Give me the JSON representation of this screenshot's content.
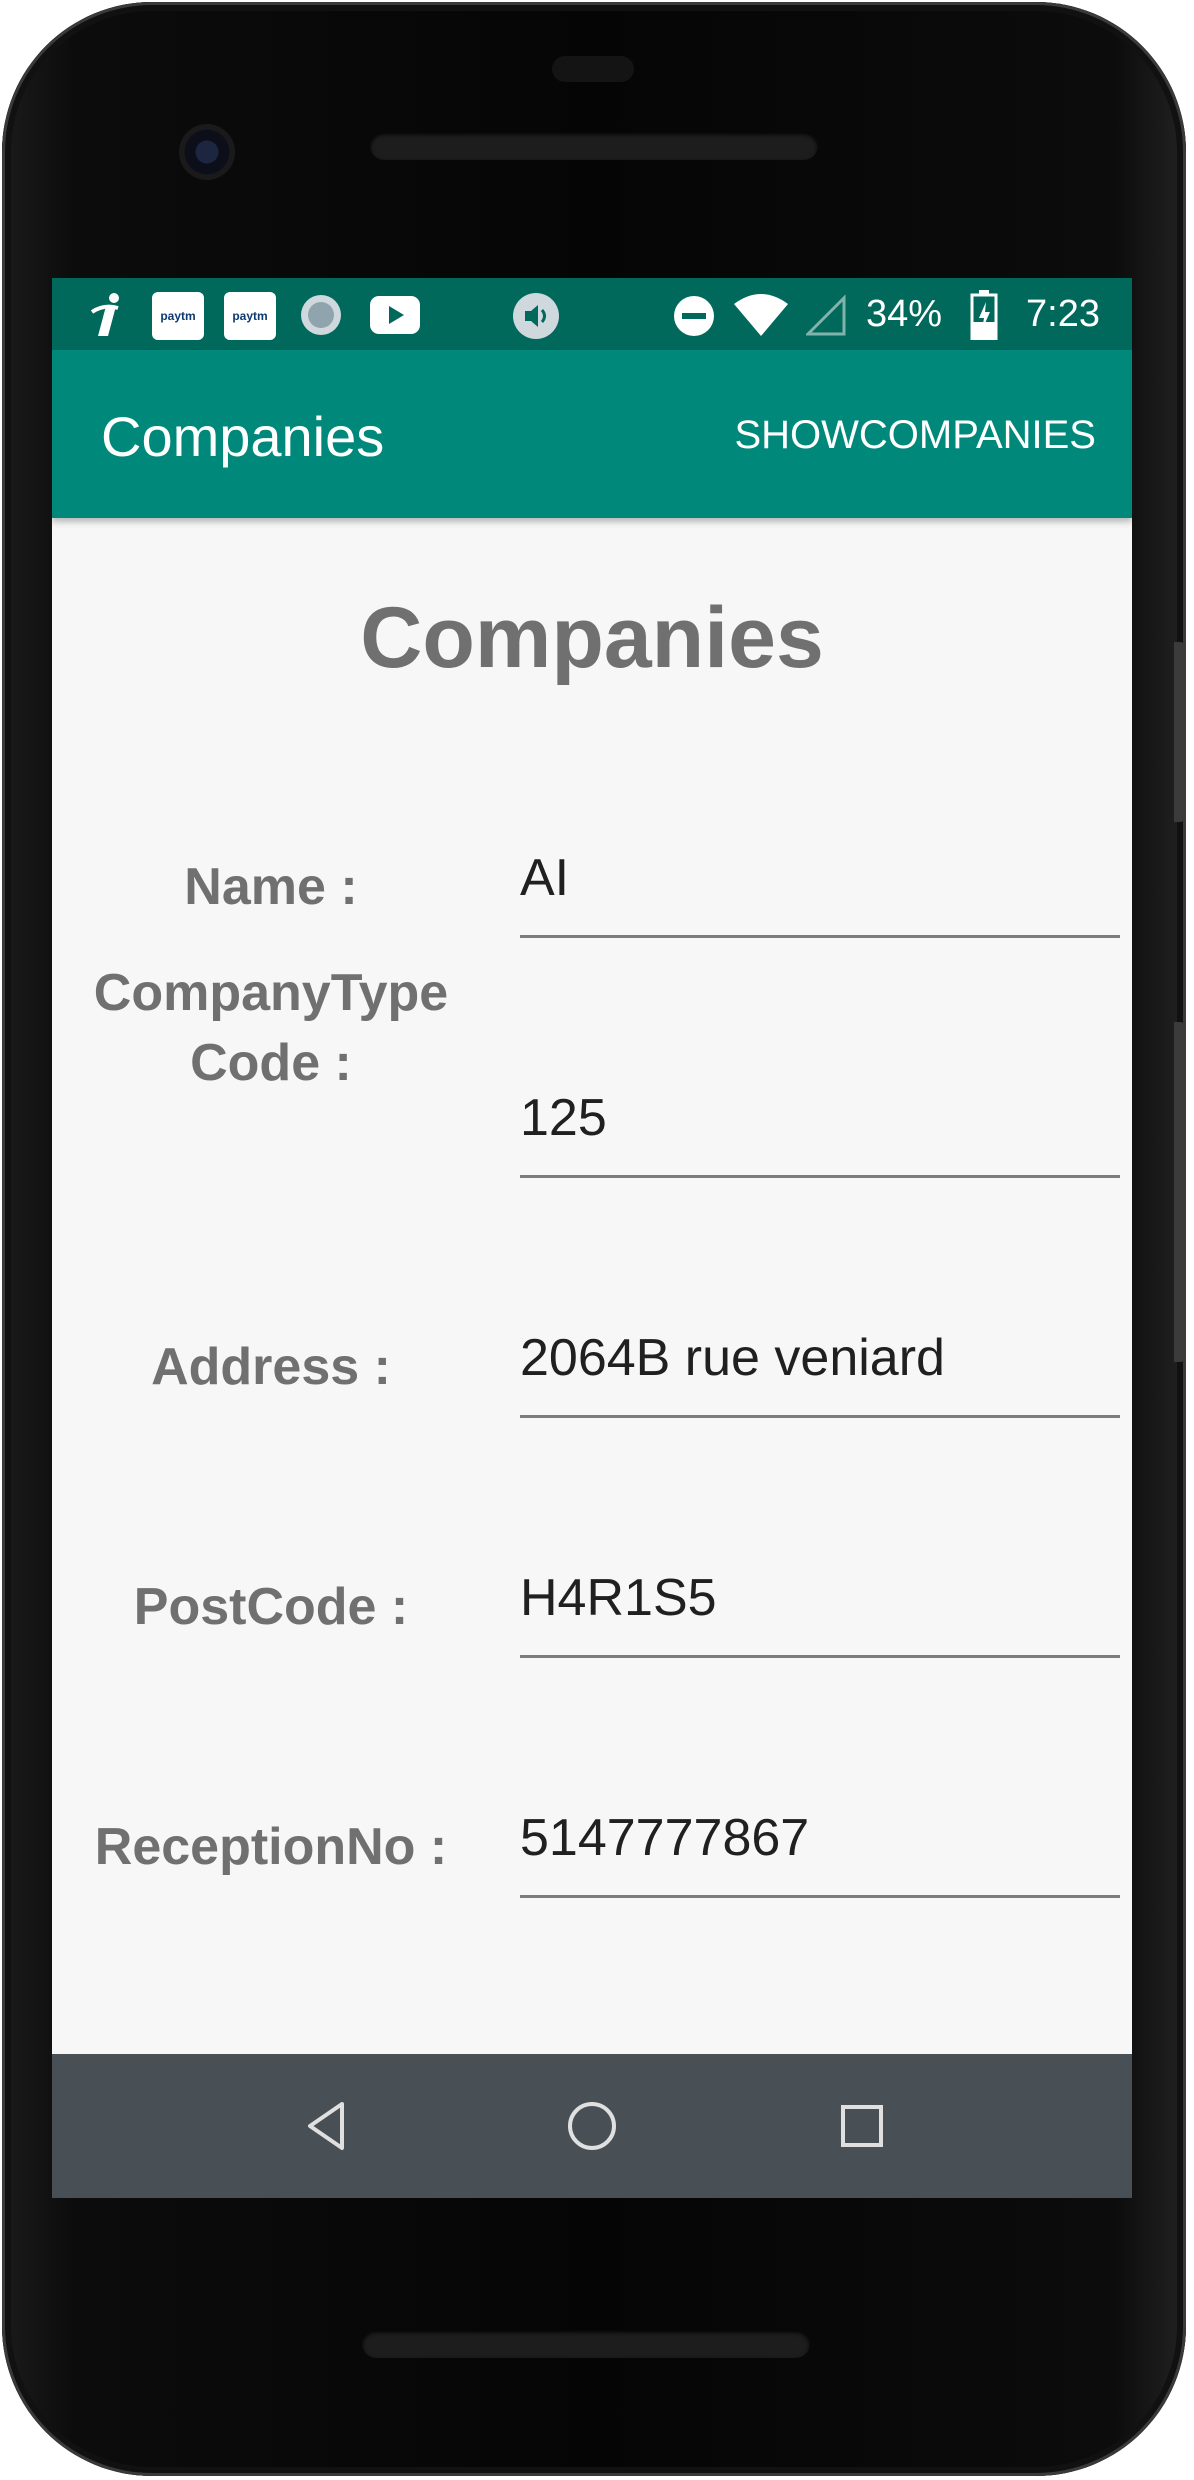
{
  "status_bar": {
    "battery": "34%",
    "time": "7:23",
    "paytm_label": "paytm"
  },
  "app_bar": {
    "title": "Companies",
    "action": "SHOWCOMPANIES"
  },
  "page": {
    "heading": "Companies",
    "fields": [
      {
        "label": "Name :",
        "value": "AI"
      },
      {
        "label": "CompanyType\nCode :",
        "value": "125"
      },
      {
        "label": "Address :",
        "value": "2064B rue veniard"
      },
      {
        "label": "PostCode :",
        "value": "H4R1S5"
      },
      {
        "label": "ReceptionNo :",
        "value": "5147777867"
      }
    ]
  },
  "colors": {
    "status_bar": "#00695c",
    "app_bar": "#00897b",
    "nav_bar": "#485055"
  }
}
